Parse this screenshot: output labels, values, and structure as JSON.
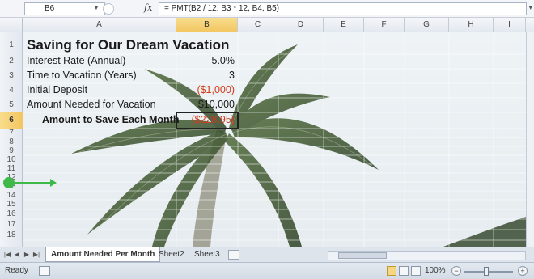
{
  "formula_bar": {
    "cell_ref": "B6",
    "formula": "= PMT(B2 / 12, B3 * 12, B4, B5)"
  },
  "columns": [
    "A",
    "B",
    "C",
    "D",
    "E",
    "F",
    "G",
    "H",
    "I"
  ],
  "selected_column": "B",
  "rows": [
    "1",
    "2",
    "3",
    "4",
    "5",
    "6",
    "7",
    "8",
    "9",
    "10",
    "11",
    "12",
    "13",
    "14",
    "15",
    "16",
    "17",
    "18"
  ],
  "selected_row": "6",
  "cells": {
    "a1": "Saving for Our Dream Vacation",
    "a2": "Interest Rate (Annual)",
    "b2": "5.0%",
    "a3": "Time to Vacation (Years)",
    "b3": "3",
    "a4": "Initial Deposit",
    "b4": "($1,000)",
    "a5": "Amount Needed for Vacation",
    "b5": "$10,000",
    "a6": "Amount to Save Each Month",
    "b6": "($228.95)"
  },
  "sheet_tabs": [
    "Amount Needed Per Month",
    "Sheet2",
    "Sheet3"
  ],
  "active_sheet": "Amount Needed Per Month",
  "status": {
    "mode": "Ready",
    "zoom": "100%"
  },
  "colors": {
    "accent_selection": "#f2c560",
    "negative_number": "#d23a1a",
    "callout": "#3fb84a"
  }
}
